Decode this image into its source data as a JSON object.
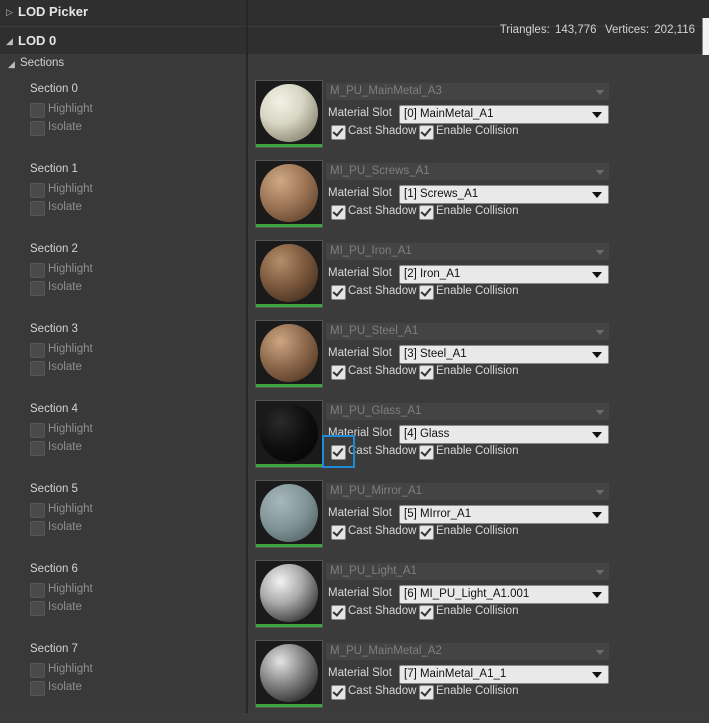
{
  "lod_picker": {
    "title": "LOD Picker"
  },
  "lod": {
    "title": "LOD 0",
    "triangles_label": "Triangles:",
    "triangles": "143,776",
    "vertices_label": "Vertices:",
    "vertices": "202,116"
  },
  "sections_title": "Sections",
  "highlight_label": "Highlight",
  "isolate_label": "Isolate",
  "material_slot_label": "Material Slot",
  "cast_shadow_label": "Cast Shadow",
  "enable_collision_label": "Enable Collision",
  "sections": [
    {
      "title": "Section 0",
      "material": "M_PU_MainMetal_A3",
      "slot": "[0] MainMetal_A1"
    },
    {
      "title": "Section 1",
      "material": "MI_PU_Screws_A1",
      "slot": "[1] Screws_A1"
    },
    {
      "title": "Section 2",
      "material": "MI_PU_Iron_A1",
      "slot": "[2] Iron_A1"
    },
    {
      "title": "Section 3",
      "material": "MI_PU_Steel_A1",
      "slot": "[3] Steel_A1"
    },
    {
      "title": "Section 4",
      "material": "MI_PU_Glass_A1",
      "slot": "[4] Glass"
    },
    {
      "title": "Section 5",
      "material": "MI_PU_Mirror_A1",
      "slot": "[5] MIrror_A1"
    },
    {
      "title": "Section 6",
      "material": "MI_PU_Light_A1",
      "slot": "[6] MI_PU_Light_A1.001"
    },
    {
      "title": "Section 7",
      "material": "M_PU_MainMetal_A2",
      "slot": "[7] MainMetal_A1_1"
    }
  ]
}
